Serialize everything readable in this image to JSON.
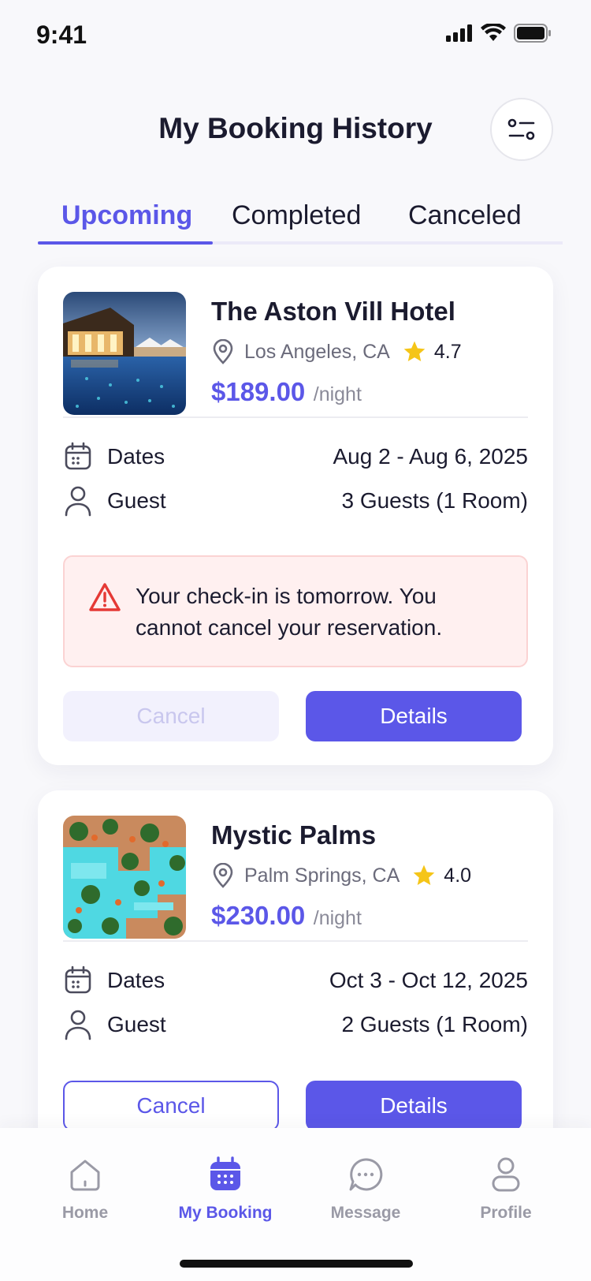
{
  "status": {
    "time": "9:41"
  },
  "header": {
    "title": "My Booking History"
  },
  "tabs": [
    {
      "label": "Upcoming",
      "active": true
    },
    {
      "label": "Completed",
      "active": false
    },
    {
      "label": "Canceled",
      "active": false
    }
  ],
  "bookings": [
    {
      "name": "The Aston Vill Hotel",
      "location": "Los Angeles, CA",
      "rating": "4.7",
      "price": "$189.00",
      "per": "/night",
      "dates_label": "Dates",
      "dates_value": "Aug 2 - Aug 6, 2025",
      "guest_label": "Guest",
      "guest_value": "3 Guests (1 Room)",
      "alert": "Your check-in is tomorrow. You cannot cancel your reservation.",
      "cancel_label": "Cancel",
      "cancel_enabled": false,
      "details_label": "Details"
    },
    {
      "name": "Mystic Palms",
      "location": "Palm Springs, CA",
      "rating": "4.0",
      "price": "$230.00",
      "per": "/night",
      "dates_label": "Dates",
      "dates_value": "Oct 3 - Oct 12, 2025",
      "guest_label": "Guest",
      "guest_value": "2 Guests (1 Room)",
      "cancel_label": "Cancel",
      "cancel_enabled": true,
      "details_label": "Details"
    }
  ],
  "nav": [
    {
      "label": "Home",
      "icon": "home-icon",
      "active": false
    },
    {
      "label": "My Booking",
      "icon": "calendar-icon",
      "active": true
    },
    {
      "label": "Message",
      "icon": "chat-icon",
      "active": false
    },
    {
      "label": "Profile",
      "icon": "profile-icon",
      "active": false
    }
  ],
  "colors": {
    "accent": "#5b57e8",
    "alert_bg": "#fff0f0",
    "alert_icon": "#e53935",
    "star": "#f5c518"
  }
}
